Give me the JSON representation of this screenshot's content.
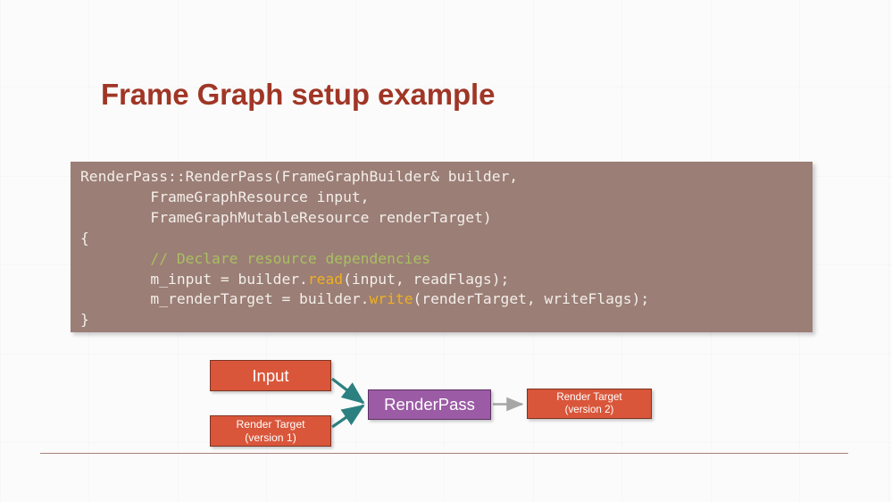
{
  "slide": {
    "title": "Frame Graph setup example",
    "title_color": "#a03626",
    "background_color": "#fbfbfb",
    "rule_color": "#a58278"
  },
  "code_block": {
    "background_color": "#9b7e76",
    "text_color": "#f3efe9",
    "comment_color": "#a9c060",
    "function_color": "#f0b020",
    "lines": [
      "RenderPass::RenderPass(FrameGraphBuilder& builder,",
      "        FrameGraphResource input,",
      "        FrameGraphMutableResource renderTarget)",
      "{",
      "        // Declare resource dependencies",
      "        m_input = builder.read(input, readFlags);",
      "        m_renderTarget = builder.write(renderTarget, writeFlags);",
      "}"
    ],
    "comment_text": "// Declare resource dependencies",
    "function_tokens": [
      "read",
      "write"
    ]
  },
  "diagram": {
    "orange_color": "#d9563a",
    "orange_border_color": "#7d3423",
    "purple_color": "#9b5ba5",
    "purple_border_color": "#5d3264",
    "teal_edge_color": "#2c8080",
    "gray_edge_color": "#a6a6a6",
    "nodes": {
      "input": {
        "label": "Input"
      },
      "render_target_v1": {
        "label_line1": "Render Target",
        "label_line2": "(version 1)"
      },
      "render_pass": {
        "label": "RenderPass"
      },
      "render_target_v2": {
        "label_line1": "Render Target",
        "label_line2": "(version 2)"
      }
    }
  }
}
